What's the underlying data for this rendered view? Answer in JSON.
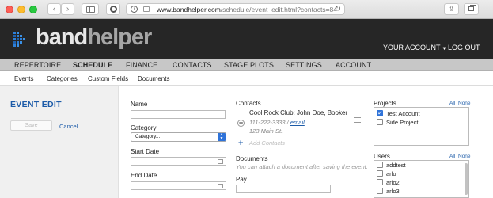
{
  "browser": {
    "url_domain": "www.bandhelper.com",
    "url_path": "/schedule/event_edit.html?contacts=84"
  },
  "header": {
    "logo_band": "band",
    "logo_helper": "helper",
    "account_label": "YOUR ACCOUNT",
    "logout_label": "LOG OUT"
  },
  "mainnav": [
    "REPERTOIRE",
    "SCHEDULE",
    "FINANCE",
    "CONTACTS",
    "STAGE PLOTS",
    "SETTINGS",
    "ACCOUNT"
  ],
  "subnav": [
    "Events",
    "Categories",
    "Custom Fields",
    "Documents"
  ],
  "left": {
    "title": "EVENT EDIT",
    "save_label": "Save",
    "cancel_label": "Cancel"
  },
  "form": {
    "name_label": "Name",
    "name_value": "",
    "category_label": "Category",
    "category_value": "Category...",
    "start_label": "Start Date",
    "end_label": "End Date"
  },
  "contacts": {
    "label": "Contacts",
    "entry_name": "Cool Rock Club: John Doe, Booker",
    "entry_phone": "111-222-3333 / ",
    "entry_email": "email",
    "entry_address": "123 Main St.",
    "add_label": "Add Contacts",
    "documents_label": "Documents",
    "documents_hint": "You can attach a document after saving the event.",
    "pay_label": "Pay"
  },
  "projects": {
    "label": "Projects",
    "all": "All",
    "none": "None",
    "items": [
      {
        "label": "Test Account",
        "checked": true
      },
      {
        "label": "Side Project",
        "checked": false
      }
    ]
  },
  "users": {
    "label": "Users",
    "all": "All",
    "none": "None",
    "items": [
      {
        "label": "addtest",
        "checked": false
      },
      {
        "label": "arlo",
        "checked": false
      },
      {
        "label": "arlo2",
        "checked": false
      },
      {
        "label": "arlo3",
        "checked": false
      }
    ]
  },
  "colors": {
    "accent": "#1c5ba8",
    "header_bg": "#262626",
    "nav_bg": "#c7c7c7",
    "checkbox_blue": "#2f73d9"
  }
}
